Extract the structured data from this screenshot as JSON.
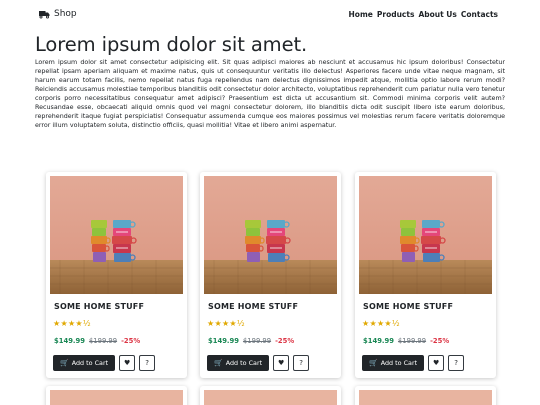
{
  "nav": {
    "brand": "Shop",
    "links": [
      "Home",
      "Products",
      "About Us",
      "Contacts"
    ]
  },
  "intro": {
    "title": "Lorem ipsum dolor sit amet.",
    "text": "Lorem ipsum dolor sit amet consectetur adipisicing elit. Sit quas adipisci maiores ab nesciunt et accusamus hic ipsum doloribus! Consectetur repellat ipsam aperiam aliquam et maxime natus, quis ut consequuntur veritatis illo delectus! Asperiores facere unde vitae neque magnam, sit harum earum totam facilis, nemo repellat natus fuga repellendus nam delectus dignissimos impedit atque, mollitia optio labore rerum modi? Reiciendis accusamus molestiae temporibus blanditiis odit consectetur dolor architecto, voluptatibus reprehenderit cum pariatur nulla vero tenetur corporis porro necessitatibus consequatur amet adipisci? Praesentium est dicta ut accusantium sit. Commodi minima corporis velit autem? Recusandae esse, obcaecati aliquid omnis quod vel magni consectetur dolorem, illo blanditiis dicta odit suscipit libero iste earum doloribus, reprehenderit itaque fugiat perspiciatis! Consequatur assumenda cumque eos maiores possimus vel molestias rerum facere veritatis doloremque error illum voluptatem soluta, distinctio officiis, quasi mollitia! Vitae et libero animi aspernatur."
  },
  "products": [
    {
      "title": "SOME HOME STUFF",
      "rating_stars": "★★★★",
      "rating_half": "½",
      "rating": 4.5,
      "price": "$149.99",
      "old_price": "$199.99",
      "discount": "-25%",
      "cart_label": "Add to Cart"
    },
    {
      "title": "SOME HOME STUFF",
      "rating_stars": "★★★★",
      "rating_half": "½",
      "rating": 4.5,
      "price": "$149.99",
      "old_price": "$199.99",
      "discount": "-25%",
      "cart_label": "Add to Cart"
    },
    {
      "title": "SOME HOME STUFF",
      "rating_stars": "★★★★",
      "rating_half": "½",
      "rating": 4.5,
      "price": "$149.99",
      "old_price": "$199.99",
      "discount": "-25%",
      "cart_label": "Add to Cart"
    }
  ],
  "icons": {
    "brand": "truck-icon",
    "cart": "cart-icon",
    "wishlist": "heart-icon",
    "details": "question-icon"
  },
  "colors": {
    "price": "#198754",
    "discount": "#dc3545",
    "star": "#e0a800",
    "button_dark": "#212529"
  }
}
